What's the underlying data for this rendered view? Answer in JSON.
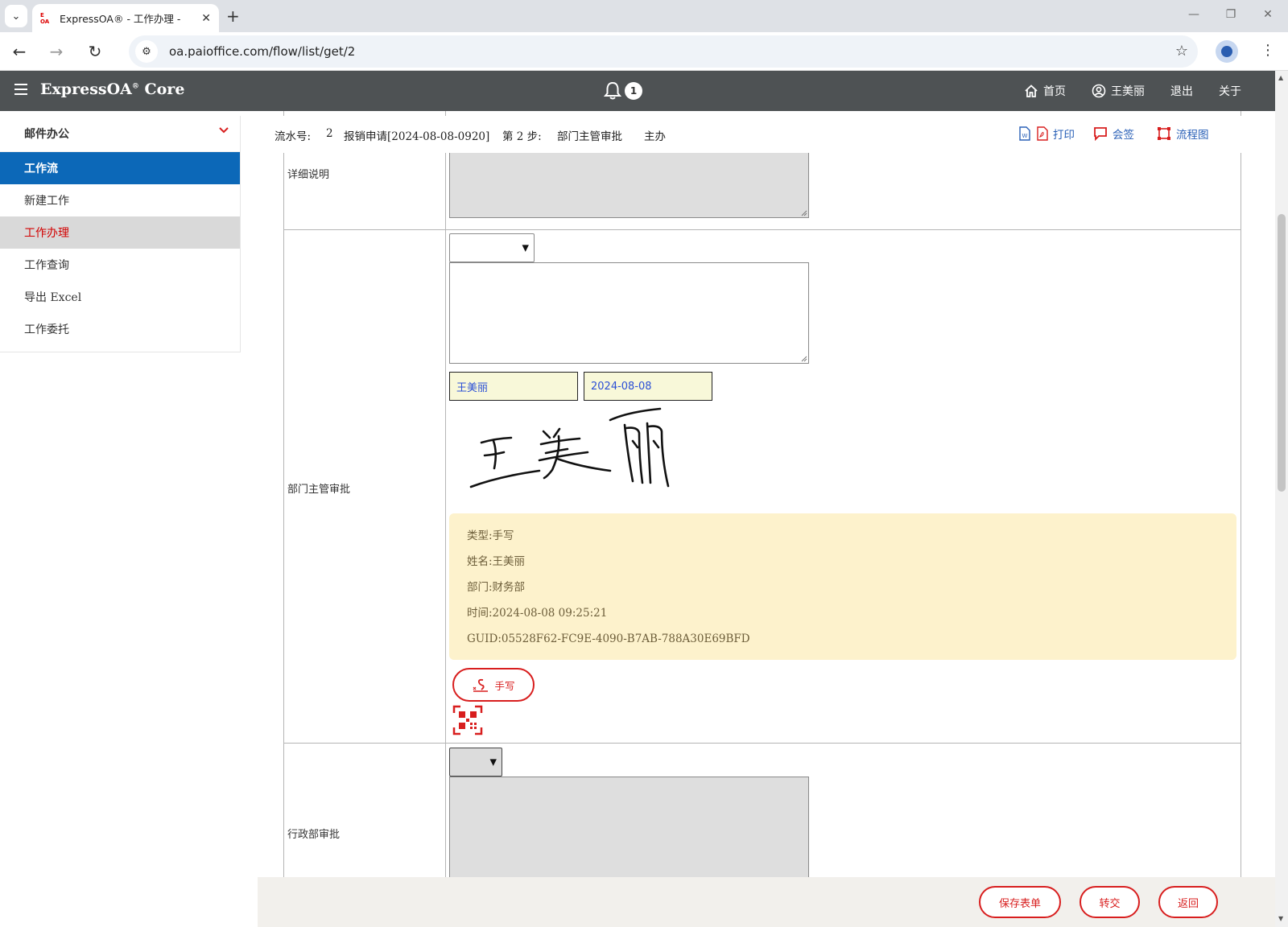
{
  "browser": {
    "tab_title": "ExpressOA® - 工作办理 - ",
    "favicon_text": "E OA",
    "url": "oa.paioffice.com/flow/list/get/2"
  },
  "header": {
    "brand": "ExpressOA",
    "brand_suffix": "Core",
    "brand_mark": "®",
    "notification_count": "1",
    "nav": {
      "home": "首页",
      "user": "王美丽",
      "logout": "退出",
      "about": "关于"
    }
  },
  "sidebar": {
    "group": "邮件办公",
    "section": "工作流",
    "items": [
      "新建工作",
      "工作办理",
      "工作查询",
      "导出 Excel",
      "工作委托"
    ],
    "active_index": 1
  },
  "infobar": {
    "serial_label": "流水号:",
    "serial_no": "2",
    "form_title": "报销申请[2024-08-08-0920]",
    "step": "第 2 步:",
    "step_name": "部门主管审批",
    "role": "主办",
    "print": "打印",
    "countersign": "会签",
    "flowchart": "流程图"
  },
  "form": {
    "detail_label": "详细说明",
    "dept_label": "部门主管审批",
    "admin_label": "行政部审批",
    "signer_name": "王美丽",
    "sign_date": "2024-08-08",
    "sign_info": {
      "type": "类型:手写",
      "name": "姓名:王美丽",
      "dept": "部门:财务部",
      "time": "时间:2024-08-08 09:25:21",
      "guid": "GUID:05528F62-FC9E-4090-B7AB-788A30E69BFD"
    },
    "handwrite_button": "手写"
  },
  "actions": {
    "save": "保存表单",
    "transfer": "转交",
    "back": "返回"
  },
  "colors": {
    "header_bg": "#4e5254",
    "sidebar_active_section": "#0c68b8",
    "accent_red": "#d81e1e",
    "link_blue": "#2a60b7",
    "info_box": "#fdf2cc"
  }
}
